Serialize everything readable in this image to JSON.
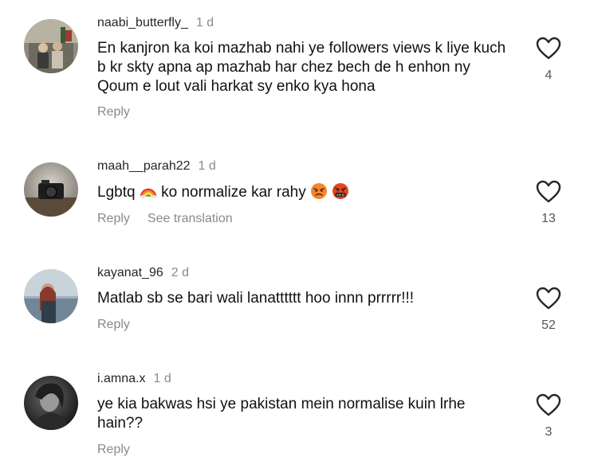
{
  "comments": [
    {
      "username": "naabi_butterfly_",
      "time": "1 d",
      "text": "En kanjron ka koi mazhab nahi ye followers views k liye kuch b kr skty apna ap mazhab har chez bech de h enhon ny Qoum e lout vali harkat sy enko kya hona",
      "reply": "Reply",
      "likes": "4",
      "avatar_icon": "group-photo-avatar"
    },
    {
      "username": "maah__parah22",
      "time": "1 d",
      "text_before": "Lgbtq",
      "emoji_rainbow": "rainbow-emoji",
      "text_after": "ko normalize kar rahy",
      "emoji_angry": "angry-face-emoji",
      "emoji_cursing": "cursing-face-emoji",
      "reply": "Reply",
      "translate": "See translation",
      "likes": "13",
      "avatar_icon": "camera-photo-avatar"
    },
    {
      "username": "kayanat_96",
      "time": "2 d",
      "text": "Matlab sb se bari wali lanatttttt hoo innn prrrrr!!!",
      "reply": "Reply",
      "likes": "52",
      "avatar_icon": "sea-photo-avatar"
    },
    {
      "username": "i.amna.x",
      "time": "1 d",
      "text": "ye kia bakwas hsi ye pakistan mein normalise kuin lrhe hain??",
      "reply": "Reply",
      "likes": "3",
      "avatar_icon": "dark-portrait-avatar"
    }
  ],
  "colors": {
    "meta_gray": "#8a8a8a",
    "text": "#111111",
    "heart_stroke": "#262626"
  }
}
